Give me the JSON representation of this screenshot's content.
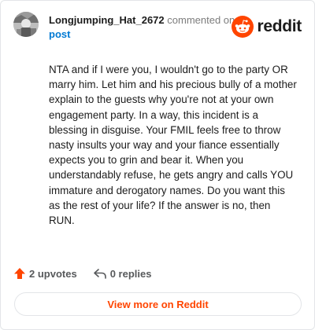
{
  "header": {
    "username": "Longjumping_Hat_2672",
    "commented_text": "commented on",
    "post_link": "post",
    "brand": "reddit",
    "brand_color": "#ff4500",
    "link_color": "#0079d3"
  },
  "comment": {
    "body": "NTA and if I were you, I wouldn't go to the party OR marry him. Let him and his precious bully of a mother explain to the guests why you're not at your own engagement party. In a way, this incident is a blessing in disguise. Your FMIL feels free to throw nasty insults your way and your fiance essentially expects you to grin and bear it. When you understandably refuse, he gets angry and calls YOU immature and derogatory names. Do you want this as the rest of your life? If the answer is no, then RUN."
  },
  "actions": {
    "upvotes": "2 upvotes",
    "replies": "0 replies",
    "upvote_icon": "upvote-arrow-icon",
    "reply_icon": "reply-arrow-icon"
  },
  "footer": {
    "view_more": "View more on Reddit"
  }
}
